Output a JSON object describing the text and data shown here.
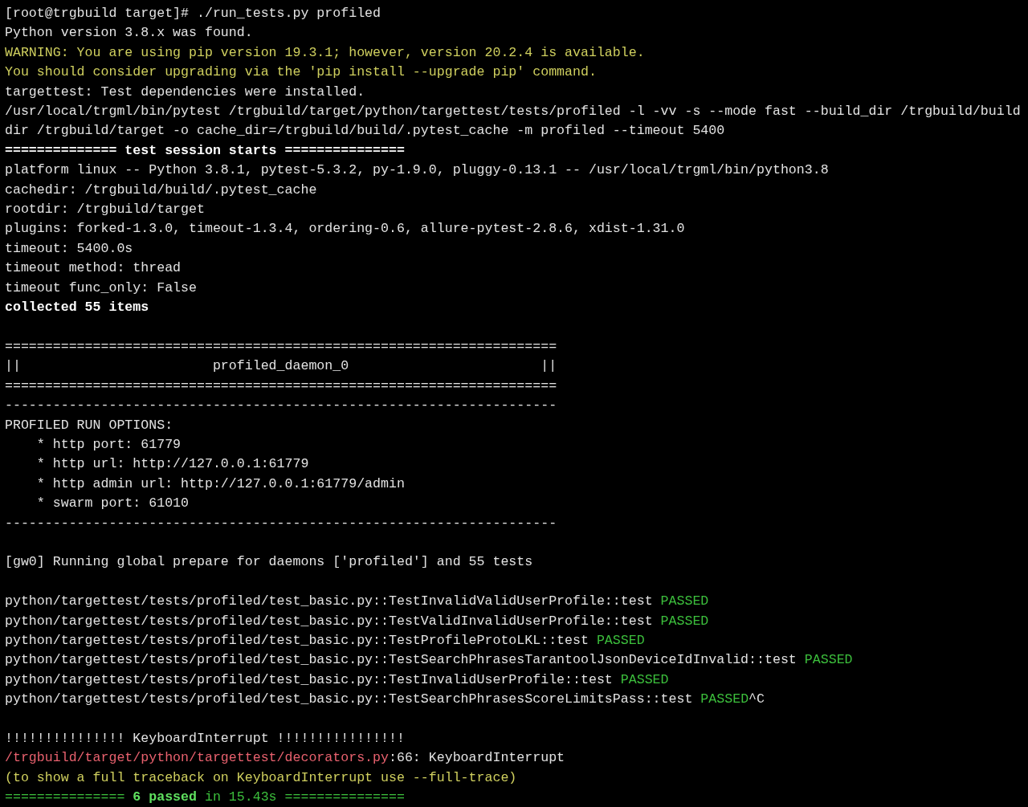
{
  "terminal": {
    "lines": [
      {
        "segments": [
          {
            "text": "[root@trgbuild target]# ./run_tests.py profiled",
            "kind": "plain"
          }
        ]
      },
      {
        "segments": [
          {
            "text": "Python version 3.8.x was found.",
            "kind": "plain"
          }
        ]
      },
      {
        "segments": [
          {
            "text": "WARNING: You are using pip version 19.3.1; however, version 20.2.4 is available.",
            "kind": "warn"
          }
        ]
      },
      {
        "segments": [
          {
            "text": "You should consider upgrading via the 'pip install --upgrade pip' command.",
            "kind": "warn"
          }
        ]
      },
      {
        "segments": [
          {
            "text": "targettest: Test dependencies were installed.",
            "kind": "plain"
          }
        ]
      },
      {
        "segments": [
          {
            "text": "/usr/local/trgml/bin/pytest /trgbuild/target/python/targettest/tests/profiled -l -vv -s --mode fast --build_dir /trgbuild/build",
            "kind": "plain"
          }
        ]
      },
      {
        "segments": [
          {
            "text": "dir /trgbuild/target -o cache_dir=/trgbuild/build/.pytest_cache -m profiled --timeout 5400",
            "kind": "plain"
          }
        ]
      },
      {
        "segments": [
          {
            "text": "============== test session starts ===============",
            "kind": "bold"
          }
        ]
      },
      {
        "segments": [
          {
            "text": "platform linux -- Python 3.8.1, pytest-5.3.2, py-1.9.0, pluggy-0.13.1 -- /usr/local/trgml/bin/python3.8",
            "kind": "plain"
          }
        ]
      },
      {
        "segments": [
          {
            "text": "cachedir: /trgbuild/build/.pytest_cache",
            "kind": "plain"
          }
        ]
      },
      {
        "segments": [
          {
            "text": "rootdir: /trgbuild/target",
            "kind": "plain"
          }
        ]
      },
      {
        "segments": [
          {
            "text": "plugins: forked-1.3.0, timeout-1.3.4, ordering-0.6, allure-pytest-2.8.6, xdist-1.31.0",
            "kind": "plain"
          }
        ]
      },
      {
        "segments": [
          {
            "text": "timeout: 5400.0s",
            "kind": "plain"
          }
        ]
      },
      {
        "segments": [
          {
            "text": "timeout method: thread",
            "kind": "plain"
          }
        ]
      },
      {
        "segments": [
          {
            "text": "timeout func_only: False",
            "kind": "plain"
          }
        ]
      },
      {
        "segments": [
          {
            "text": "collected 55 items",
            "kind": "bold"
          }
        ]
      },
      {
        "blank_before": true,
        "segments": [
          {
            "text": "=====================================================================",
            "kind": "plain"
          }
        ]
      },
      {
        "segments": [
          {
            "text": "||                        profiled_daemon_0                        ||",
            "kind": "plain"
          }
        ]
      },
      {
        "segments": [
          {
            "text": "=====================================================================",
            "kind": "plain"
          }
        ]
      },
      {
        "segments": [
          {
            "text": "---------------------------------------------------------------------",
            "kind": "plain"
          }
        ]
      },
      {
        "segments": [
          {
            "text": "PROFILED RUN OPTIONS:",
            "kind": "plain"
          }
        ]
      },
      {
        "segments": [
          {
            "text": "    * http port: 61779",
            "kind": "plain"
          }
        ]
      },
      {
        "segments": [
          {
            "text": "    * http url: http://127.0.0.1:61779",
            "kind": "plain"
          }
        ]
      },
      {
        "segments": [
          {
            "text": "    * http admin url: http://127.0.0.1:61779/admin",
            "kind": "plain"
          }
        ]
      },
      {
        "segments": [
          {
            "text": "    * swarm port: 61010",
            "kind": "plain"
          }
        ]
      },
      {
        "segments": [
          {
            "text": "---------------------------------------------------------------------",
            "kind": "plain"
          }
        ]
      },
      {
        "blank_before": true,
        "segments": [
          {
            "text": "[gw0] Running global prepare for daemons ['profiled'] and 55 tests",
            "kind": "plain"
          }
        ]
      },
      {
        "blank_before": true,
        "segments": [
          {
            "text": "python/targettest/tests/profiled/test_basic.py::TestInvalidValidUserProfile::test ",
            "kind": "plain"
          },
          {
            "text": "PASSED",
            "kind": "pass"
          }
        ]
      },
      {
        "segments": [
          {
            "text": "python/targettest/tests/profiled/test_basic.py::TestValidInvalidUserProfile::test ",
            "kind": "plain"
          },
          {
            "text": "PASSED",
            "kind": "pass"
          }
        ]
      },
      {
        "segments": [
          {
            "text": "python/targettest/tests/profiled/test_basic.py::TestProfileProtoLKL::test ",
            "kind": "plain"
          },
          {
            "text": "PASSED",
            "kind": "pass"
          }
        ]
      },
      {
        "segments": [
          {
            "text": "python/targettest/tests/profiled/test_basic.py::TestSearchPhrasesTarantoolJsonDeviceIdInvalid::test ",
            "kind": "plain"
          },
          {
            "text": "PASSED",
            "kind": "pass"
          }
        ]
      },
      {
        "segments": [
          {
            "text": "python/targettest/tests/profiled/test_basic.py::TestInvalidUserProfile::test ",
            "kind": "plain"
          },
          {
            "text": "PASSED",
            "kind": "pass"
          }
        ]
      },
      {
        "segments": [
          {
            "text": "python/targettest/tests/profiled/test_basic.py::TestSearchPhrasesScoreLimitsPass::test ",
            "kind": "plain"
          },
          {
            "text": "PASSED",
            "kind": "pass"
          },
          {
            "text": "^C",
            "kind": "plain"
          }
        ]
      },
      {
        "blank_before": true,
        "segments": [
          {
            "text": "!!!!!!!!!!!!!!! KeyboardInterrupt !!!!!!!!!!!!!!!!",
            "kind": "plain"
          }
        ]
      },
      {
        "segments": [
          {
            "text": "/trgbuild/target/python/targettest/decorators.py",
            "kind": "error"
          },
          {
            "text": ":66: KeyboardInterrupt",
            "kind": "plain"
          }
        ]
      },
      {
        "segments": [
          {
            "text": "(to show a full traceback on KeyboardInterrupt use --full-trace)",
            "kind": "warn"
          }
        ]
      },
      {
        "segments": [
          {
            "text": "=============== ",
            "kind": "pass"
          },
          {
            "text": "6 passed",
            "kind": "pass_bold"
          },
          {
            "text": " in 15.43s ===============",
            "kind": "pass"
          }
        ]
      }
    ]
  }
}
